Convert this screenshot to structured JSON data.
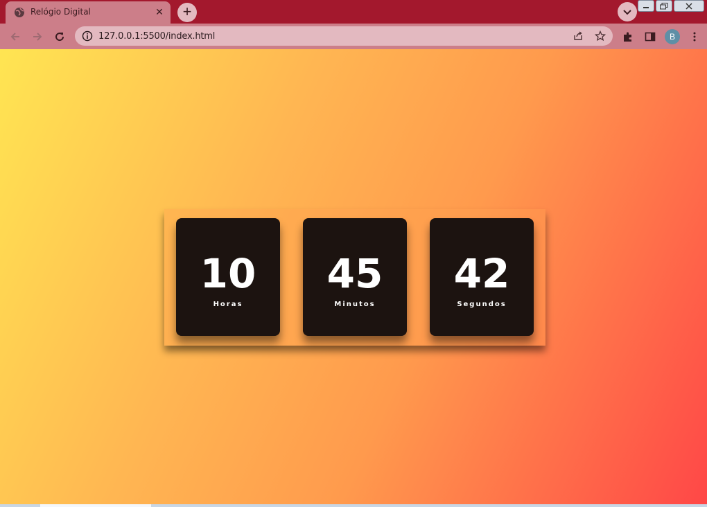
{
  "browser": {
    "tab": {
      "title": "Relógio Digital"
    },
    "address_bar": {
      "url": "127.0.0.1:5500/index.html"
    },
    "profile_initial": "B"
  },
  "colors": {
    "tabstrip": "#a3182d",
    "toolbar": "#cc7e89",
    "card": "#1c1310",
    "gradient_start": "#ffe552",
    "gradient_end": "#ff4747"
  },
  "clock": {
    "units": [
      {
        "value": "10",
        "label": "Horas"
      },
      {
        "value": "45",
        "label": "Minutos"
      },
      {
        "value": "42",
        "label": "Segundos"
      }
    ]
  }
}
